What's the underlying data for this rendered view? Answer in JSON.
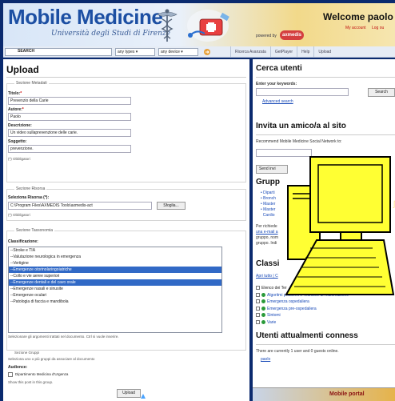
{
  "header": {
    "logo": "Mobile Medicine",
    "logo_sub": "Università degli Studi di Firenze",
    "powered_by": "powered by",
    "axmedis": "axmedis",
    "welcome": "Welcome paolo",
    "account_links": [
      "My account",
      "Log ou"
    ]
  },
  "toolbar": {
    "search_label": "SEARCH",
    "types_select": "any types",
    "device_select": "any device",
    "nav": [
      "Ricerca Avanzata",
      "GetPlayer",
      "Help",
      "Upload"
    ]
  },
  "upload": {
    "title": "Upload",
    "meta_section": "Sezione Metadati",
    "titolo_label": "Titolo:",
    "titolo_value": "Prevenzio della Carie",
    "autore_label": "Autore:",
    "autore_value": "Paolo",
    "descr_label": "Descrizione:",
    "descr_value": "Un video sullaprevenzione delle carie.",
    "soggetto_label": "Soggetto:",
    "soggetto_value": "prevenzione.",
    "obbligatori": "(*) Obbligatori",
    "risorsa_section": "Sezione Risorsa",
    "risorsa_label": "Seleziona Risorsa (*):",
    "risorsa_path": "C:\\Program Files\\AXMEDIS Tools\\axmedis-act",
    "browse": "Sfoglia...",
    "obbligatori2": "(*) Obbligatori",
    "tass_section": "Sezione Tassonomia",
    "class_label": "Classificazione:",
    "class_options": [
      {
        "text": "--Stroke e TIA",
        "hl": false
      },
      {
        "text": "--Valutazione neurologica in emergenza",
        "hl": false
      },
      {
        "text": "--Vertigine",
        "hl": false
      },
      {
        "text": "--Emergenze otorinolaringoiatriche",
        "hl": true
      },
      {
        "text": "--Collo e vie aeree superiori",
        "hl": false
      },
      {
        "text": "--Emergenze dentali e del cavo orale",
        "hl": true
      },
      {
        "text": "--Emergenze nasali e sinusite",
        "hl": false
      },
      {
        "text": "--Emergenze oculari",
        "hl": false
      },
      {
        "text": "--Patologia di faccia e mandibola",
        "hl": false
      }
    ],
    "class_note": "Selezionare gli argomenti trattati nel documento. Ctrl si vuole inserire.",
    "gruppi_section": "Sezione Gruppi",
    "gruppi_note": "Seleziona uno o più gruppi da associare al documento",
    "audience_label": "Audience:",
    "audience_item": "Dipartimento Medicina d'Urgenza",
    "show_post": "Show this post in this group.",
    "upload_btn": "Upload"
  },
  "right": {
    "cerca_title": "Cerca utenti",
    "keywords_label": "Enter your keywords:",
    "search_btn": "Search",
    "adv_search": "Advanced search",
    "invita_title": "Invita un amico/a al sito",
    "recommend": "Recommend Mobile Medicine Social Network to:",
    "send_btn": "Send invi",
    "gruppi_title": "Grupp",
    "group_items": [
      "Diparti",
      "Bronch",
      "Master",
      "Master",
      "Cardio"
    ],
    "group_note_lines": [
      "Per richiede",
      "una e-mail a",
      "gruppo, nom",
      "gruppo. Indi"
    ],
    "classi_title": "Classi",
    "tree_links": "Apri tutto | C",
    "tree_root": "Elenco dei Ter",
    "tree_items": [
      "Algoritmi problemi e Tecniche di Rianimazione",
      "Emergenza ospedaliera",
      "Emergenza pre-ospedaliera",
      "Sintomi",
      "Varie"
    ],
    "utenti_title": "Utenti attualmenti conness",
    "utenti_text": "There are currently 1 user and 0 guests online.",
    "utenti_user": "paolo",
    "portal": "Mobile portal"
  },
  "colors": {
    "brand_blue": "#1c4fa3",
    "highlight": "#3169c6",
    "frame": "#0b2a6e",
    "computer_yellow": "#ffff33"
  },
  "icons": [
    "caduceus-icon",
    "medical-kit-icon",
    "go-arrow-icon",
    "computer-clipart-icon",
    "plus-icon",
    "group-bullet-icon",
    "cursor-icon"
  ]
}
